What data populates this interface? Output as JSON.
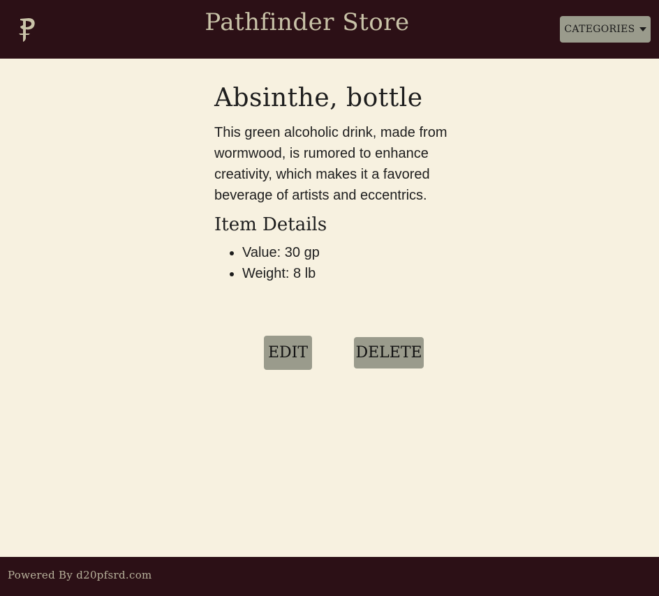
{
  "header": {
    "title": "Pathfinder Store",
    "logo_icon": "pathfinder-p-logo",
    "categories_label": "CATEGORIES"
  },
  "item": {
    "name": "Absinthe, bottle",
    "description": "This green alcoholic drink, made from wormwood, is rumored to enhance creativity, which makes it a favored beverage of artists and eccentrics.",
    "details_heading": "Item Details",
    "details": [
      "Value: 30 gp",
      "Weight: 8 lb"
    ]
  },
  "actions": {
    "edit_label": "EDIT",
    "delete_label": "DELETE"
  },
  "footer": {
    "text": "Powered By d20pfsrd.com"
  },
  "colors": {
    "navbar": "#2c1016",
    "background": "#f7f1e0",
    "button": "#9a9b8c",
    "title_text": "#c9c3a8"
  }
}
